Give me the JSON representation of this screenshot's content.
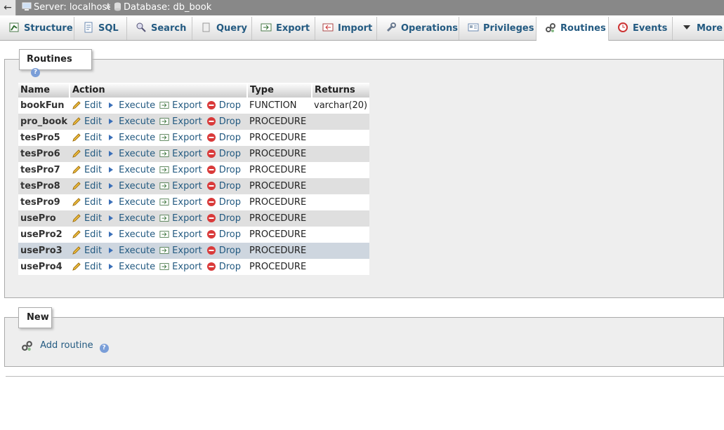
{
  "breadcrumb": {
    "server": "Server: localhost",
    "sep": "»",
    "database": "Database: db_book"
  },
  "tabs": [
    {
      "label": "Structure",
      "icon": "structure-icon"
    },
    {
      "label": "SQL",
      "icon": "sql-icon"
    },
    {
      "label": "Search",
      "icon": "search-icon"
    },
    {
      "label": "Query",
      "icon": "query-icon"
    },
    {
      "label": "Export",
      "icon": "export-icon"
    },
    {
      "label": "Import",
      "icon": "import-icon"
    },
    {
      "label": "Operations",
      "icon": "wrench-icon"
    },
    {
      "label": "Privileges",
      "icon": "privileges-icon"
    },
    {
      "label": "Routines",
      "icon": "routines-icon"
    },
    {
      "label": "Events",
      "icon": "clock-icon"
    },
    {
      "label": "More",
      "icon": "chevron-down-icon"
    }
  ],
  "routines": {
    "legend": "Routines",
    "headers": {
      "name": "Name",
      "action": "Action",
      "type": "Type",
      "returns": "Returns"
    },
    "actions": {
      "edit": "Edit",
      "execute": "Execute",
      "export": "Export",
      "drop": "Drop"
    },
    "rows": [
      {
        "name": "bookFun",
        "type": "FUNCTION",
        "returns": "varchar(20)"
      },
      {
        "name": "pro_book",
        "type": "PROCEDURE",
        "returns": ""
      },
      {
        "name": "tesPro5",
        "type": "PROCEDURE",
        "returns": ""
      },
      {
        "name": "tesPro6",
        "type": "PROCEDURE",
        "returns": ""
      },
      {
        "name": "tesPro7",
        "type": "PROCEDURE",
        "returns": ""
      },
      {
        "name": "tesPro8",
        "type": "PROCEDURE",
        "returns": ""
      },
      {
        "name": "tesPro9",
        "type": "PROCEDURE",
        "returns": ""
      },
      {
        "name": "usePro",
        "type": "PROCEDURE",
        "returns": ""
      },
      {
        "name": "usePro2",
        "type": "PROCEDURE",
        "returns": ""
      },
      {
        "name": "usePro3",
        "type": "PROCEDURE",
        "returns": ""
      },
      {
        "name": "usePro4",
        "type": "PROCEDURE",
        "returns": ""
      }
    ]
  },
  "new_section": {
    "legend": "New",
    "add_label": "Add routine"
  },
  "help_glyph": "?",
  "back_glyph": "←"
}
